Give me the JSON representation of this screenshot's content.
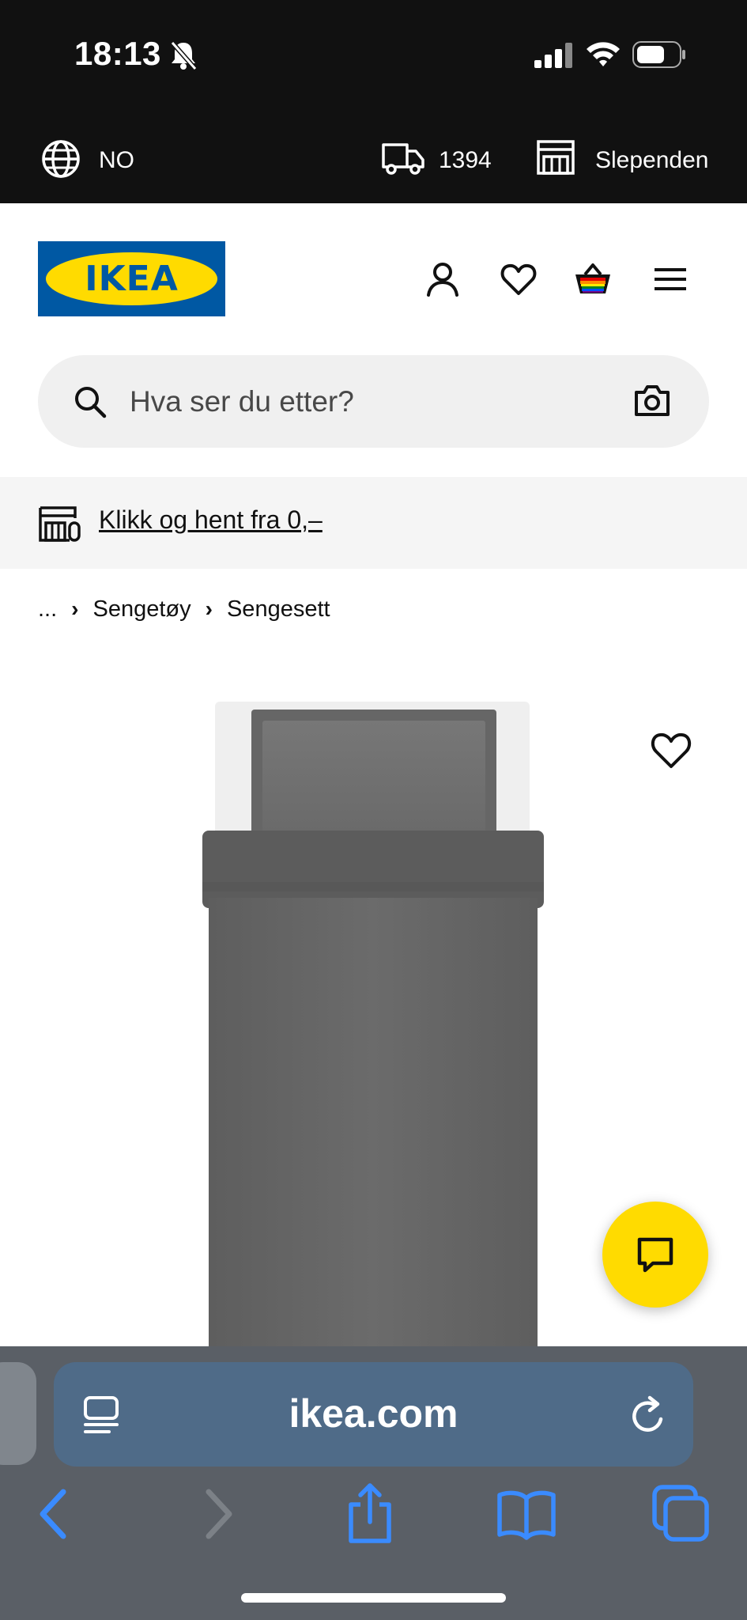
{
  "status_bar": {
    "time": "18:13"
  },
  "util_bar": {
    "language": "NO",
    "postal_code": "1394",
    "store": "Slependen"
  },
  "header": {
    "logo_text": "IKEA",
    "search_placeholder": "Hva ser du etter?"
  },
  "promo": {
    "text": "Klikk og hent fra 0,–"
  },
  "breadcrumb": {
    "items": [
      "...",
      "Sengetøy",
      "Sengesett"
    ]
  },
  "browser": {
    "url": "ikea.com"
  },
  "colors": {
    "ikea_blue": "#0058a3",
    "ikea_yellow": "#ffdb00",
    "safari_accent": "#3a8bff"
  },
  "icons": {
    "status": [
      "bell-slash-icon",
      "signal-icon",
      "wifi-icon",
      "battery-icon"
    ],
    "util": [
      "globe-icon",
      "truck-icon",
      "store-icon"
    ],
    "header": [
      "profile-icon",
      "heart-icon",
      "basket-icon",
      "menu-icon"
    ],
    "search": [
      "search-icon",
      "camera-icon"
    ],
    "safari": [
      "reader-icon",
      "reload-icon",
      "back-icon",
      "forward-icon",
      "share-icon",
      "bookmarks-icon",
      "tabs-icon"
    ]
  }
}
